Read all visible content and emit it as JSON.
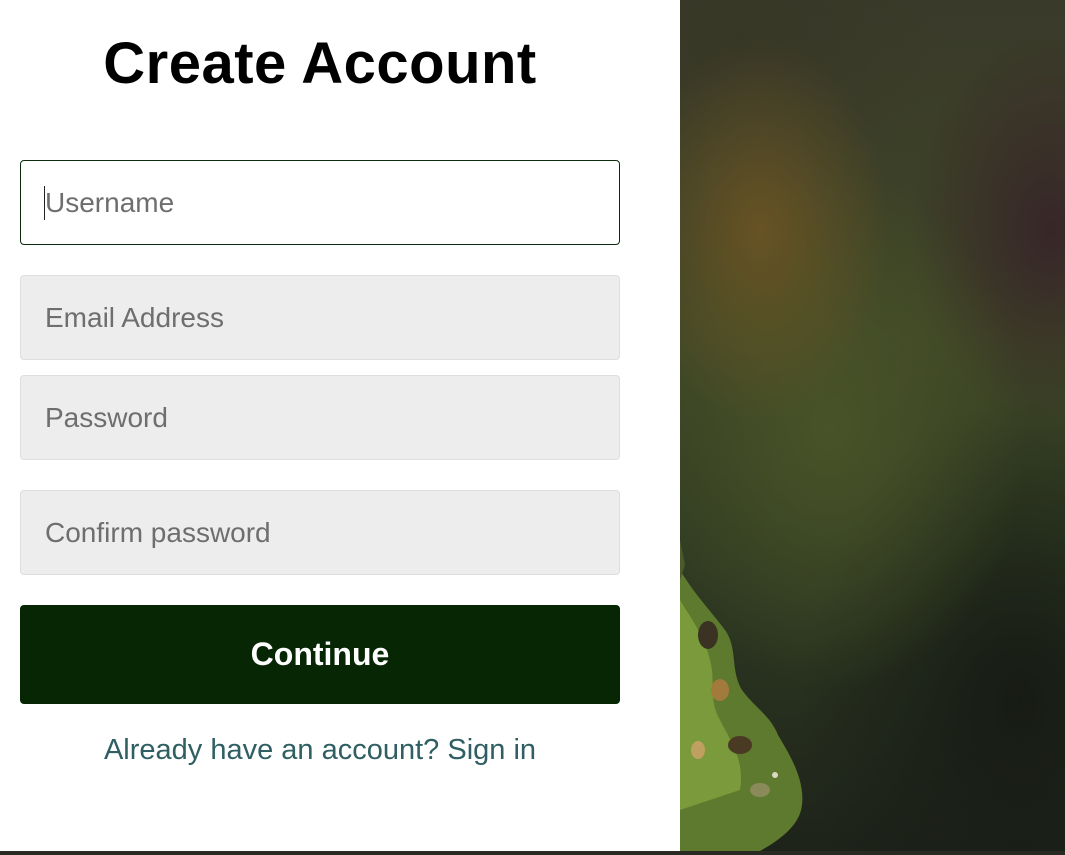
{
  "title": "Create Account",
  "fields": {
    "username": {
      "placeholder": "Username",
      "value": ""
    },
    "email": {
      "placeholder": "Email Address",
      "value": ""
    },
    "password": {
      "placeholder": "Password",
      "value": ""
    },
    "confirm": {
      "placeholder": "Confirm password",
      "value": ""
    }
  },
  "continue_label": "Continue",
  "signin_text": "Already have an account? Sign in",
  "colors": {
    "primary_button": "#062604",
    "link": "#2f5f62",
    "input_bg": "#ededed",
    "focus_border": "#0c2a0c"
  }
}
